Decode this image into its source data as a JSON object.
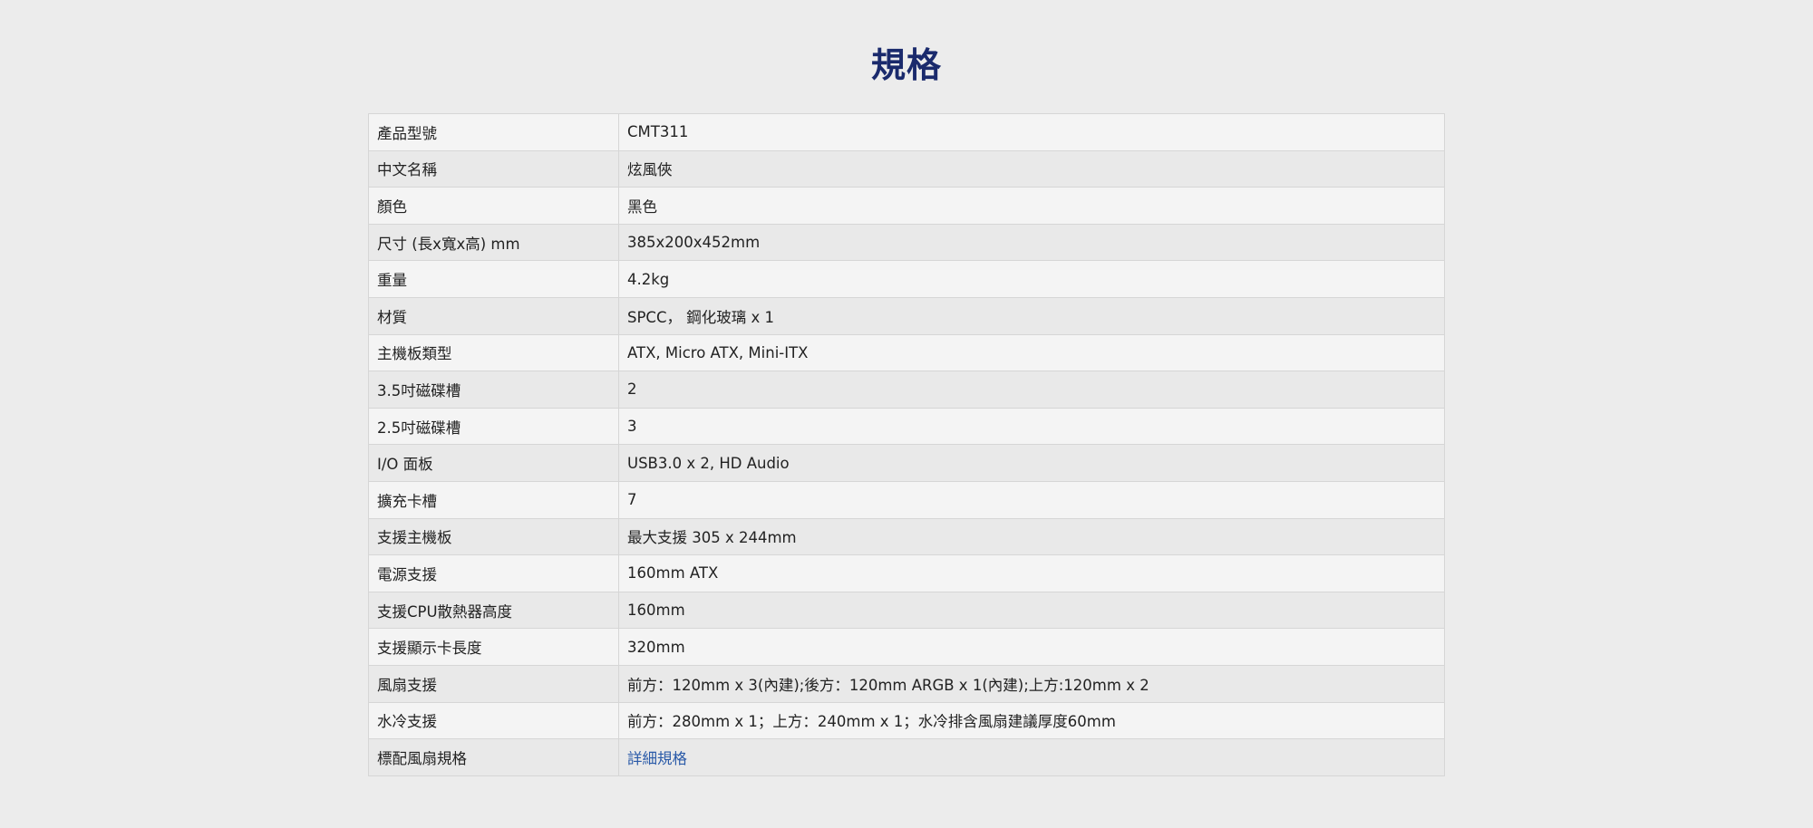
{
  "heading": "規格",
  "specs": [
    {
      "label": "產品型號",
      "value": "CMT311"
    },
    {
      "label": "中文名稱",
      "value": "炫風俠"
    },
    {
      "label": "顏色",
      "value": "黑色"
    },
    {
      "label": "尺寸 (長x寬x高) mm",
      "value": "385x200x452mm"
    },
    {
      "label": "重量",
      "value": "4.2kg"
    },
    {
      "label": "材質",
      "value": "SPCC， 鋼化玻璃 x 1"
    },
    {
      "label": "主機板類型",
      "value": "ATX, Micro ATX, Mini-ITX"
    },
    {
      "label": "3.5吋磁碟槽",
      "value": "2"
    },
    {
      "label": "2.5吋磁碟槽",
      "value": "3"
    },
    {
      "label": "I/O 面板",
      "value": "USB3.0 x 2, HD Audio"
    },
    {
      "label": "擴充卡槽",
      "value": "7"
    },
    {
      "label": "支援主機板",
      "value": "最大支援 305 x 244mm"
    },
    {
      "label": "電源支援",
      "value": "160mm ATX"
    },
    {
      "label": "支援CPU散熱器高度",
      "value": "160mm"
    },
    {
      "label": "支援顯示卡長度",
      "value": "320mm"
    },
    {
      "label": "風扇支援",
      "value": "前方：120mm x 3(內建);後方：120mm ARGB x 1(內建);上方:120mm x 2"
    },
    {
      "label": "水冷支援",
      "value": "前方：280mm x 1；上方：240mm x 1；水冷排含風扇建議厚度60mm"
    },
    {
      "label": "標配風扇規格",
      "value": "詳細規格"
    }
  ],
  "colors": {
    "heading": "#1a2a6c",
    "link": "#2a5aa8",
    "background": "#ececec"
  }
}
